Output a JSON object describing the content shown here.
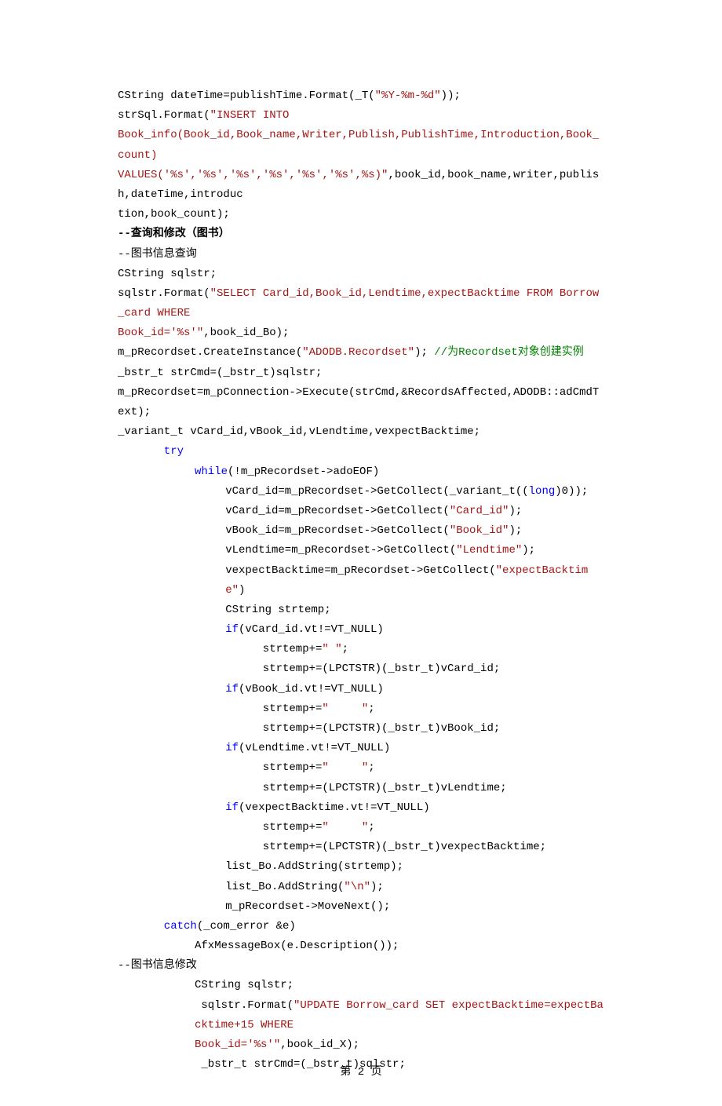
{
  "lines": {
    "l1a": "CString dateTime=publishTime.Format(_T(",
    "l1b": "\"%Y-%m-%d\"",
    "l1c": "));",
    "l2a": "strSql.Format(",
    "l2b": "\"INSERT INTO",
    "l3": "Book_info(Book_id,Book_name,Writer,Publish,PublishTime,Introduction,Book_count)",
    "l4a": "VALUES('%s','%s','%s','%s','%s','%s',%s)\"",
    "l4b": ",book_id,book_name,writer,publish,dateTime,introduc",
    "l5": "tion,book_count);",
    "l6": "--查询和修改（图书）",
    "l7": "--图书信息查询",
    "l8": "CString sqlstr;",
    "l9a": "sqlstr.Format(",
    "l9b": "\"SELECT Card_id,Book_id,Lendtime,expectBacktime FROM Borrow_card WHERE",
    "l10a": "Book_id='%s'\"",
    "l10b": ",book_id_Bo);",
    "l11a": "m_pRecordset.CreateInstance(",
    "l11b": "\"ADODB.Recordset\"",
    "l11c": "); ",
    "l11d": "//为Recordset对象创建实例",
    "l12": "_bstr_t strCmd=(_bstr_t)sqlstr;",
    "l13": "m_pRecordset=m_pConnection->Execute(strCmd,&RecordsAffected,ADODB::adCmdText);",
    "l14": "_variant_t vCard_id,vBook_id,vLendtime,vexpectBacktime;",
    "l15": "try",
    "l16a": "while",
    "l16b": "(!m_pRecordset->adoEOF)",
    "l17a": "vCard_id=m_pRecordset->GetCollect(_variant_t((",
    "l17b": "long",
    "l17c": ")0));",
    "l18a": "vCard_id=m_pRecordset->GetCollect(",
    "l18b": "\"Card_id\"",
    "l18c": ");",
    "l19a": "vBook_id=m_pRecordset->GetCollect(",
    "l19b": "\"Book_id\"",
    "l19c": ");",
    "l20a": "vLendtime=m_pRecordset->GetCollect(",
    "l20b": "\"Lendtime\"",
    "l20c": ");",
    "l21a": "vexpectBacktime=m_pRecordset->GetCollect(",
    "l21b": "\"expectBacktime\"",
    "l21c": ")",
    "l22": "CString strtemp;",
    "l23a": "if",
    "l23b": "(vCard_id.vt!=VT_NULL)",
    "l24a": " strtemp+=",
    "l24b": "\" \"",
    "l24c": ";",
    "l25": " strtemp+=(LPCTSTR)(_bstr_t)vCard_id;",
    "l26a": "if",
    "l26b": "(vBook_id.vt!=VT_NULL)",
    "l27a": " strtemp+=",
    "l27b": "\"     \"",
    "l27c": ";",
    "l28": " strtemp+=(LPCTSTR)(_bstr_t)vBook_id;",
    "l29a": "if",
    "l29b": "(vLendtime.vt!=VT_NULL)",
    "l30a": " strtemp+=",
    "l30b": "\"     \"",
    "l30c": ";",
    "l31": " strtemp+=(LPCTSTR)(_bstr_t)vLendtime;",
    "l32a": "if",
    "l32b": "(vexpectBacktime.vt!=VT_NULL)",
    "l33a": " strtemp+=",
    "l33b": "\"     \"",
    "l33c": ";",
    "l34": " strtemp+=(LPCTSTR)(_bstr_t)vexpectBacktime;",
    "l35": "list_Bo.AddString(strtemp);",
    "l36a": "list_Bo.AddString(",
    "l36b": "\"\\n\"",
    "l36c": ");",
    "l37": "m_pRecordset->MoveNext();",
    "l38a": "catch",
    "l38b": "(_com_error &e)",
    "l39": "AfxMessageBox(e.Description());",
    "l40": "--图书信息修改",
    "l41": "CString sqlstr;",
    "l42a": " sqlstr.Format(",
    "l42b": "\"UPDATE Borrow_card SET expectBacktime=expectBacktime+15 WHERE",
    "l43a": "Book_id='%s'\"",
    "l43b": ",book_id_X);",
    "l44": " _bstr_t strCmd=(_bstr_t)sqlstr;"
  },
  "footer": "第 2 页"
}
